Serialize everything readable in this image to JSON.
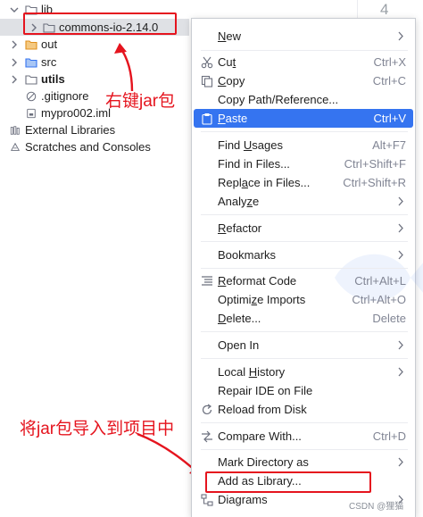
{
  "tree": {
    "items": [
      {
        "label": "lib",
        "icon": "folder-icon",
        "expanded": true
      },
      {
        "label": "commons-io-2.14.0",
        "icon": "folder-icon",
        "expanded": false
      },
      {
        "label": "out",
        "icon": "folder-orange-icon",
        "expanded": false
      },
      {
        "label": "src",
        "icon": "folder-blue-icon",
        "expanded": false
      },
      {
        "label": "utils",
        "icon": "folder-icon",
        "expanded": false
      },
      {
        "label": ".gitignore",
        "icon": "ignore-file-icon"
      },
      {
        "label": "mypro002.iml",
        "icon": "module-file-icon"
      },
      {
        "label": "External Libraries",
        "icon": "libraries-icon",
        "expanded": false
      },
      {
        "label": "Scratches and Consoles",
        "icon": "scratches-icon",
        "expanded": false
      }
    ]
  },
  "annotations": {
    "right_click_jar": "右键jar包",
    "import_jar": "将jar包导入到项目中"
  },
  "editor": {
    "line_number": "4"
  },
  "menu": {
    "items": [
      {
        "label": "New",
        "mnemonic": "N",
        "shortcut": "",
        "submenu": true,
        "icon": ""
      },
      {
        "label": "Cut",
        "mnemonic": "t",
        "shortcut": "Ctrl+X",
        "submenu": false,
        "icon": "scissors-icon"
      },
      {
        "label": "Copy",
        "mnemonic": "C",
        "shortcut": "Ctrl+C",
        "submenu": false,
        "icon": "copy-icon"
      },
      {
        "label": "Copy Path/Reference...",
        "mnemonic": "",
        "shortcut": "",
        "submenu": false,
        "icon": ""
      },
      {
        "label": "Paste",
        "mnemonic": "P",
        "shortcut": "Ctrl+V",
        "submenu": false,
        "icon": "paste-icon",
        "selected": true
      },
      {
        "label": "Find Usages",
        "mnemonic": "U",
        "shortcut": "Alt+F7",
        "submenu": false,
        "icon": ""
      },
      {
        "label": "Find in Files...",
        "mnemonic": "",
        "shortcut": "Ctrl+Shift+F",
        "submenu": false,
        "icon": ""
      },
      {
        "label": "Replace in Files...",
        "mnemonic": "a",
        "shortcut": "Ctrl+Shift+R",
        "submenu": false,
        "icon": ""
      },
      {
        "label": "Analyze",
        "mnemonic": "z",
        "shortcut": "",
        "submenu": true,
        "icon": ""
      },
      {
        "label": "Refactor",
        "mnemonic": "R",
        "shortcut": "",
        "submenu": true,
        "icon": ""
      },
      {
        "label": "Bookmarks",
        "mnemonic": "",
        "shortcut": "",
        "submenu": true,
        "icon": ""
      },
      {
        "label": "Reformat Code",
        "mnemonic": "R",
        "shortcut": "Ctrl+Alt+L",
        "submenu": false,
        "icon": "reformat-icon"
      },
      {
        "label": "Optimize Imports",
        "mnemonic": "z",
        "shortcut": "Ctrl+Alt+O",
        "submenu": false,
        "icon": ""
      },
      {
        "label": "Delete...",
        "mnemonic": "D",
        "shortcut": "Delete",
        "submenu": false,
        "icon": ""
      },
      {
        "label": "Open In",
        "mnemonic": "",
        "shortcut": "",
        "submenu": true,
        "icon": ""
      },
      {
        "label": "Local History",
        "mnemonic": "H",
        "shortcut": "",
        "submenu": true,
        "icon": ""
      },
      {
        "label": "Repair IDE on File",
        "mnemonic": "",
        "shortcut": "",
        "submenu": false,
        "icon": ""
      },
      {
        "label": "Reload from Disk",
        "mnemonic": "",
        "shortcut": "",
        "submenu": false,
        "icon": "reload-icon"
      },
      {
        "label": "Compare With...",
        "mnemonic": "",
        "shortcut": "Ctrl+D",
        "submenu": false,
        "icon": "compare-icon"
      },
      {
        "label": "Mark Directory as",
        "mnemonic": "",
        "shortcut": "",
        "submenu": true,
        "icon": ""
      },
      {
        "label": "Add as Library...",
        "mnemonic": "",
        "shortcut": "",
        "submenu": false,
        "icon": ""
      },
      {
        "label": "Diagrams",
        "mnemonic": "",
        "shortcut": "",
        "submenu": true,
        "icon": "diagrams-icon"
      }
    ]
  },
  "watermark": "CSDN @狸猫",
  "colors": {
    "selection": "#3574f0",
    "annotation_red": "#e5141e",
    "tree_selected": "#dfe1e5",
    "shortcut_gray": "#818594"
  }
}
